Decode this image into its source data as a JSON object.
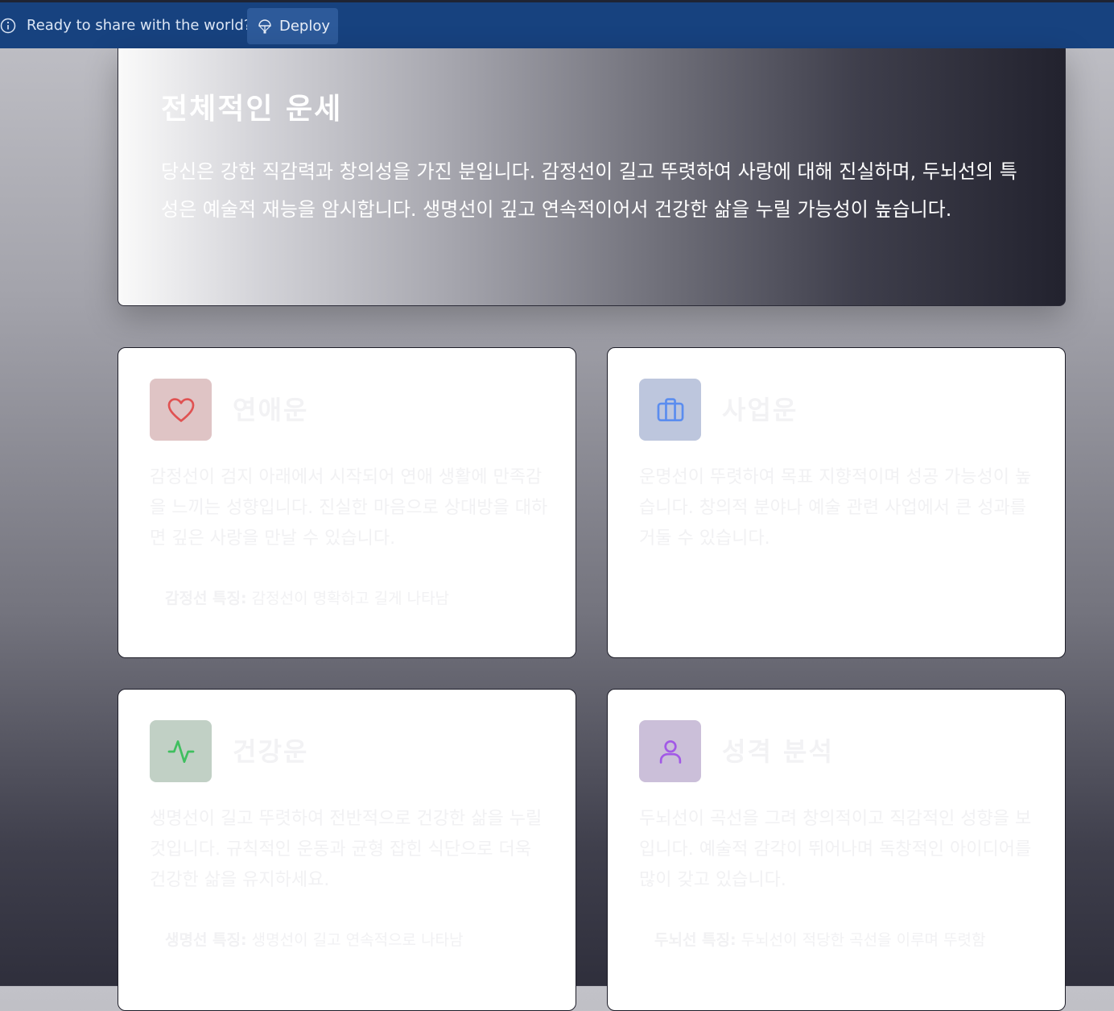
{
  "banner": {
    "message": "Ready to share with the world?",
    "deploy_label": "Deploy"
  },
  "hero": {
    "title": "전체적인 운세",
    "text": "당신은 강한 직감력과 창의성을 가진 분입니다. 감정선이 길고 뚜렷하여 사랑에 대해 진실하며, 두뇌선의 특성은 예술적 재능을 암시합니다. 생명선이 깊고 연속적이어서 건강한 삶을 누릴 가능성이 높습니다."
  },
  "cards": [
    {
      "title": "연애운",
      "icon": "heart-icon",
      "color": "#e05252",
      "text": "감정선이 검지 아래에서 시작되어 연애 생활에 만족감을 느끼는 성향입니다. 진실한 마음으로 상대방을 대하면 깊은 사랑을 만날 수 있습니다.",
      "feature_label": "감정선 특징:",
      "feature_value": "감정선이 명확하고 길게 나타남"
    },
    {
      "title": "사업운",
      "icon": "briefcase-icon",
      "color": "#5b8def",
      "text": "운명선이 뚜렷하여 목표 지향적이며 성공 가능성이 높습니다. 창의적 분야나 예술 관련 사업에서 큰 성과를 거둘 수 있습니다."
    },
    {
      "title": "건강운",
      "icon": "activity-icon",
      "color": "#3fbf5f",
      "text": "생명선이 길고 뚜렷하여 전반적으로 건강한 삶을 누릴 것입니다. 규칙적인 운동과 균형 잡힌 식단으로 더욱 건강한 삶을 유지하세요.",
      "feature_label": "생명선 특징:",
      "feature_value": "생명선이 길고 연속적으로 나타남"
    },
    {
      "title": "성격 분석",
      "icon": "user-icon",
      "color": "#a259e6",
      "text": "두뇌선이 곡선을 그려 창의적이고 직감적인 성향을 보입니다. 예술적 감각이 뛰어나며 독창적인 아이디어를 많이 갖고 있습니다.",
      "feature_label": "두뇌선 특징:",
      "feature_value": "두뇌선이 적당한 곡선을 이루며 뚜렷함"
    }
  ]
}
